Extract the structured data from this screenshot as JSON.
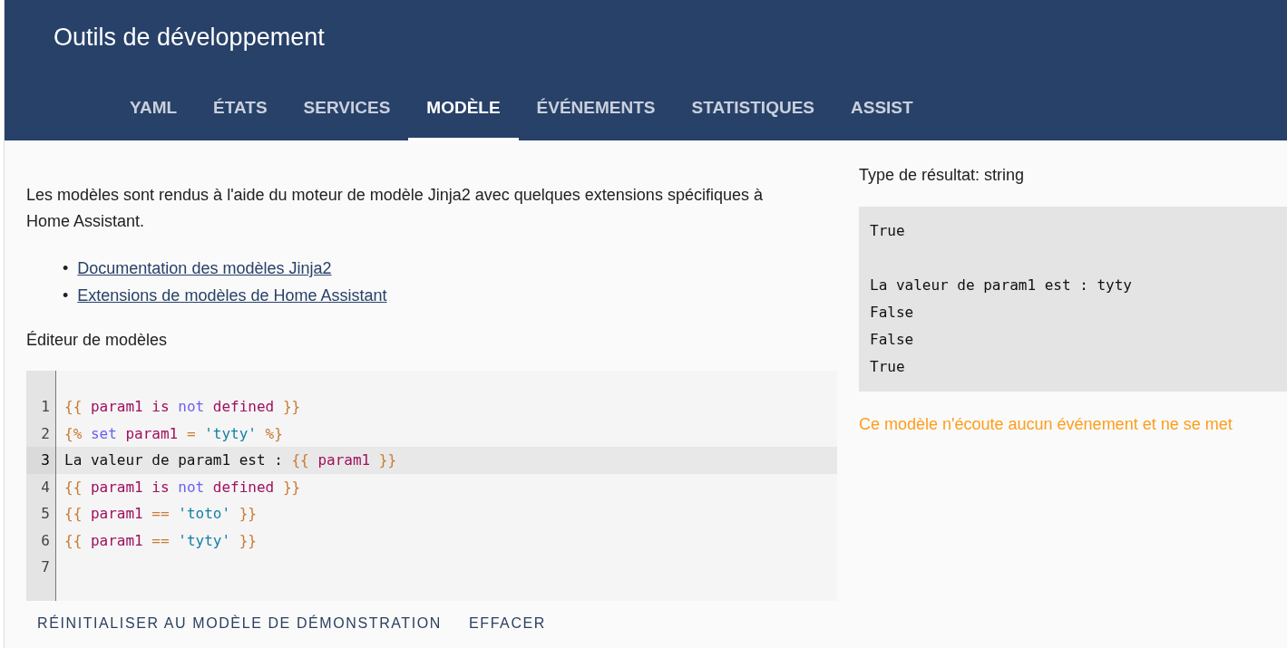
{
  "header": {
    "title": "Outils de développement"
  },
  "tabs": [
    {
      "label": "YAML",
      "selected": false
    },
    {
      "label": "ÉTATS",
      "selected": false
    },
    {
      "label": "SERVICES",
      "selected": false
    },
    {
      "label": "MODÈLE",
      "selected": true
    },
    {
      "label": "ÉVÉNEMENTS",
      "selected": false
    },
    {
      "label": "STATISTIQUES",
      "selected": false
    },
    {
      "label": "ASSIST",
      "selected": false
    }
  ],
  "intro": "Les modèles sont rendus à l'aide du moteur de modèle Jinja2 avec quelques extensions spécifiques à Home Assistant.",
  "links": [
    {
      "marker": "•",
      "text": "Documentation des modèles Jinja2"
    },
    {
      "marker": "•",
      "text": "Extensions de modèles de Home Assistant"
    }
  ],
  "editor": {
    "label": "Éditeur de modèles",
    "lines": [
      {
        "number": "1",
        "active": false,
        "tokens": [
          {
            "text": "{{",
            "kind": "delim"
          },
          {
            "text": "param1",
            "kind": "var"
          },
          {
            "text": "is",
            "kind": "var"
          },
          {
            "text": "not",
            "kind": "keyword"
          },
          {
            "text": "defined",
            "kind": "var"
          },
          {
            "text": "}}",
            "kind": "delim"
          }
        ]
      },
      {
        "number": "2",
        "active": false,
        "tokens": [
          {
            "text": "{%",
            "kind": "delim"
          },
          {
            "text": "set",
            "kind": "keyword"
          },
          {
            "text": "param1",
            "kind": "var"
          },
          {
            "text": "=",
            "kind": "op"
          },
          {
            "text": "'tyty'",
            "kind": "string"
          },
          {
            "text": "%}",
            "kind": "delim"
          }
        ]
      },
      {
        "number": "3",
        "active": true,
        "tokens": [
          {
            "text": "La valeur de param1 est :",
            "kind": "plain"
          },
          {
            "text": "{{",
            "kind": "delim"
          },
          {
            "text": "param1",
            "kind": "var"
          },
          {
            "text": "}}",
            "kind": "delim"
          }
        ]
      },
      {
        "number": "4",
        "active": false,
        "tokens": [
          {
            "text": "{{",
            "kind": "delim"
          },
          {
            "text": "param1",
            "kind": "var"
          },
          {
            "text": "is",
            "kind": "var"
          },
          {
            "text": "not",
            "kind": "keyword"
          },
          {
            "text": "defined",
            "kind": "var"
          },
          {
            "text": "}}",
            "kind": "delim"
          }
        ]
      },
      {
        "number": "5",
        "active": false,
        "tokens": [
          {
            "text": "{{",
            "kind": "delim"
          },
          {
            "text": "param1",
            "kind": "var"
          },
          {
            "text": "==",
            "kind": "op"
          },
          {
            "text": "'toto'",
            "kind": "string"
          },
          {
            "text": "}}",
            "kind": "delim"
          }
        ]
      },
      {
        "number": "6",
        "active": false,
        "tokens": [
          {
            "text": "{{",
            "kind": "delim"
          },
          {
            "text": "param1",
            "kind": "var"
          },
          {
            "text": "==",
            "kind": "op"
          },
          {
            "text": "'tyty'",
            "kind": "string"
          },
          {
            "text": "}}",
            "kind": "delim"
          }
        ]
      },
      {
        "number": "7",
        "active": false
      }
    ]
  },
  "buttons": [
    "RÉINITIALISER AU MODÈLE DE DÉMONSTRATION",
    "EFFACER"
  ],
  "result": {
    "type_label": "Type de résultat: string",
    "output_blocks": [
      {
        "lines": [
          "True"
        ]
      },
      {
        "lines": [
          "La valeur de param1 est : tyty",
          "False",
          "False",
          "True"
        ]
      }
    ],
    "notice": "Ce modèle n'écoute aucun événement et ne se met"
  }
}
